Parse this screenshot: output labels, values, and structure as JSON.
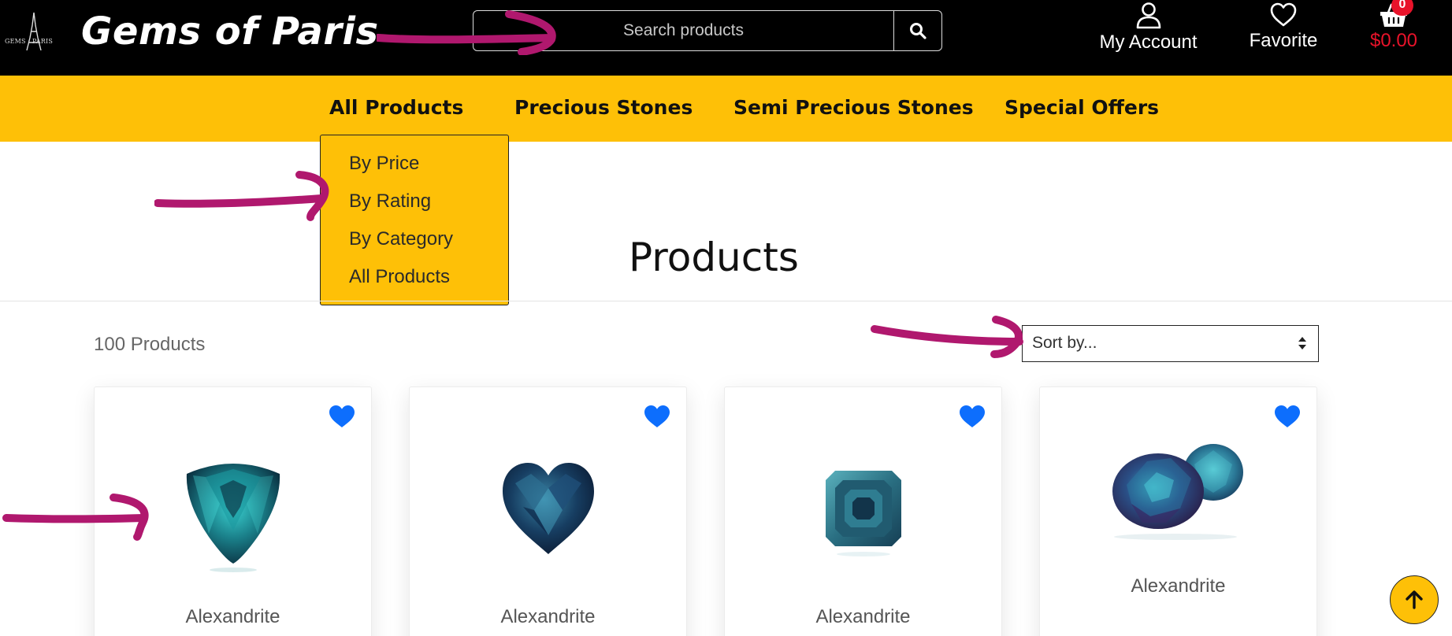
{
  "header": {
    "logo_text": "GEMS · PARIS",
    "brand": "Gems of Paris",
    "search_placeholder": "Search products",
    "account_label": "My Account",
    "favorite_label": "Favorite",
    "cart_count": "0",
    "cart_total": "$0.00"
  },
  "nav": {
    "items": [
      "All Products",
      "Precious Stones",
      "Semi Precious Stones",
      "Special Offers"
    ]
  },
  "dropdown": {
    "items": [
      "By Price",
      "By Rating",
      "By Category",
      "All Products"
    ]
  },
  "main": {
    "title": "Products",
    "count": "100 Products",
    "sort_label": "Sort by..."
  },
  "products": [
    {
      "name": "Alexandrite"
    },
    {
      "name": "Alexandrite"
    },
    {
      "name": "Alexandrite"
    },
    {
      "name": "Alexandrite"
    }
  ],
  "colors": {
    "header_bg": "#000000",
    "accent_yellow": "#fec007",
    "favorite_blue": "#0d6efd",
    "cart_red": "#e8132a",
    "annotation_magenta": "#b0186e"
  },
  "icons": [
    "search-icon",
    "user-icon",
    "heart-icon",
    "basket-icon",
    "sort-arrows-icon",
    "arrow-up-icon"
  ]
}
